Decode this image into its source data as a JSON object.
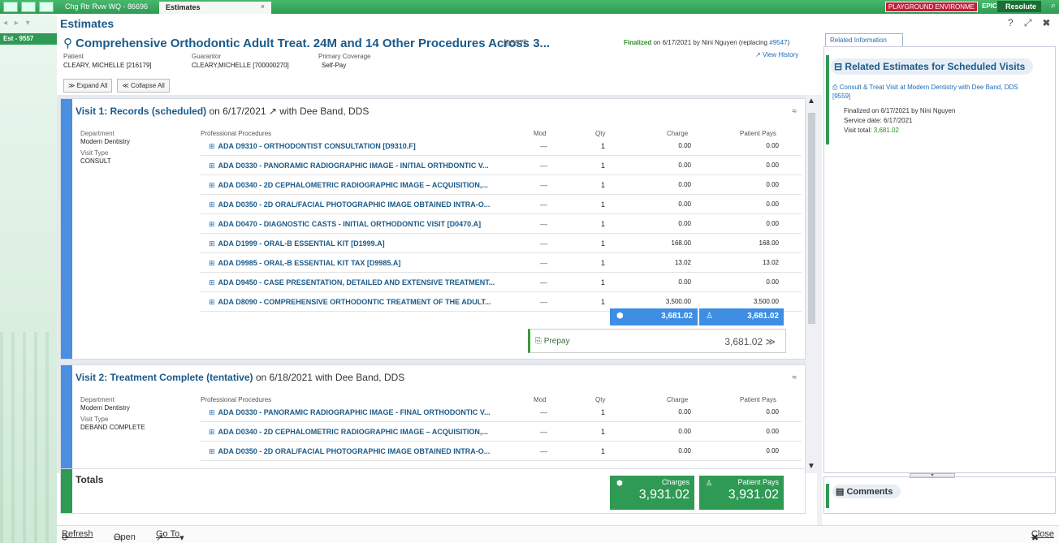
{
  "topbar": {
    "tabs": [
      "Chg Rtr Rvw WQ - 86696",
      "Estimates"
    ],
    "close": "×",
    "environment": "PLAYGROUND ENVIRONME",
    "user": "EPIC R.",
    "app": "Resolute"
  },
  "left": {
    "est_tab": "Est - 9557"
  },
  "page": {
    "title": "Estimates",
    "controls": "? ⤢ ✖"
  },
  "header": {
    "icon": "tooth-icon",
    "title": "Comprehensive Orthodontic Adult Treat. 24M and 14 Other Procedures Across 3...",
    "id": "[9557]",
    "status": "Finalized",
    "status_text": "on 6/17/2021 by Nini Nguyen (replacing",
    "replacing": "#9547",
    "status_end": ")",
    "view_history": "View History",
    "patient_label": "Patient",
    "patient": "CLEARY, MICHELLE [216179]",
    "guarantor_label": "Guarantor",
    "guarantor": "CLEARY,MICHELLE [700000270]",
    "coverage_label": "Primary Coverage",
    "coverage": "Self-Pay",
    "expand_all": "Expand All",
    "collapse_all": "Collapse All"
  },
  "columns": {
    "dept": "Department",
    "visit_type": "Visit Type",
    "procs": "Professional Procedures",
    "mod": "Mod",
    "qty": "Qty",
    "charge": "Charge",
    "pays": "Patient Pays"
  },
  "visit1": {
    "title": "Visit 1: Records (scheduled)",
    "rest": "on 6/17/2021 ↗ with Dee Band, DDS",
    "department": "Modern Dentistry",
    "visit_type": "CONSULT",
    "procedures": [
      {
        "name": "ADA D9310 - ORTHODONTIST CONSULTATION [D9310.F]",
        "mod": "—",
        "qty": "1",
        "charge": "0.00",
        "pays": "0.00"
      },
      {
        "name": "ADA D0330 - PANORAMIC RADIOGRAPHIC IMAGE - INITIAL ORTHDONTIC V...",
        "mod": "—",
        "qty": "1",
        "charge": "0.00",
        "pays": "0.00"
      },
      {
        "name": "ADA D0340 - 2D CEPHALOMETRIC RADIOGRAPHIC IMAGE – ACQUISITION,...",
        "mod": "—",
        "qty": "1",
        "charge": "0.00",
        "pays": "0.00"
      },
      {
        "name": "ADA D0350 - 2D ORAL/FACIAL PHOTOGRAPHIC IMAGE OBTAINED INTRA-O...",
        "mod": "—",
        "qty": "1",
        "charge": "0.00",
        "pays": "0.00"
      },
      {
        "name": "ADA D0470 - DIAGNOSTIC CASTS - INITIAL ORTHODONTIC VISIT [D0470.A]",
        "mod": "—",
        "qty": "1",
        "charge": "0.00",
        "pays": "0.00"
      },
      {
        "name": "ADA D1999 - ORAL-B ESSENTIAL KIT [D1999.A]",
        "mod": "—",
        "qty": "1",
        "charge": "168.00",
        "pays": "168.00"
      },
      {
        "name": "ADA D9985 - ORAL-B ESSENTIAL KIT TAX [D9985.A]",
        "mod": "—",
        "qty": "1",
        "charge": "13.02",
        "pays": "13.02"
      },
      {
        "name": "ADA D9450 - CASE PRESENTATION, DETAILED AND EXTENSIVE TREATMENT...",
        "mod": "—",
        "qty": "1",
        "charge": "0.00",
        "pays": "0.00"
      },
      {
        "name": "ADA D8090 - COMPREHENSIVE ORTHODONTIC TREATMENT OF THE ADULT...",
        "mod": "—",
        "qty": "1",
        "charge": "3,500.00",
        "pays": "3,500.00"
      }
    ],
    "sum_charge": "3,681.02",
    "sum_pays": "3,681.02",
    "prepay_label": "Prepay",
    "prepay_value": "3,681.02"
  },
  "visit2": {
    "title": "Visit 2: Treatment Complete (tentative)",
    "rest": "on 6/18/2021 with Dee Band, DDS",
    "department": "Modern Dentistry",
    "visit_type": "DEBAND COMPLETE",
    "procedures": [
      {
        "name": "ADA D0330 - PANORAMIC RADIOGRAPHIC IMAGE - FINAL ORTHODONTIC V...",
        "mod": "—",
        "qty": "1",
        "charge": "0.00",
        "pays": "0.00"
      },
      {
        "name": "ADA D0340 - 2D CEPHALOMETRIC RADIOGRAPHIC IMAGE – ACQUISITION,...",
        "mod": "—",
        "qty": "1",
        "charge": "0.00",
        "pays": "0.00"
      },
      {
        "name": "ADA D0350 - 2D ORAL/FACIAL PHOTOGRAPHIC IMAGE OBTAINED INTRA-O...",
        "mod": "—",
        "qty": "1",
        "charge": "0.00",
        "pays": "0.00"
      }
    ]
  },
  "totals": {
    "title": "Totals",
    "charges_label": "Charges",
    "charges": "3,931.02",
    "pays_label": "Patient Pays",
    "pays": "3,931.02"
  },
  "right_panel": {
    "tab": "Related Information",
    "heading": "Related Estimates for Scheduled Visits",
    "link": "Consult & Treat Visit at Modern Dentistry with Dee Band, DDS [9559]",
    "finalized": "Finalized on 6/17/2021 by Nini Nguyen",
    "service_date_label": "Service date:",
    "service_date": "6/17/2021",
    "visit_total_label": "Visit total:",
    "visit_total": "3,681.02",
    "comments": "Comments"
  },
  "bottom": {
    "refresh": "Refresh",
    "open": "Open",
    "goto": "Go To",
    "close": "Close"
  },
  "colors": {
    "accent_green": "#2f9a53",
    "accent_blue": "#3e8ee4",
    "title_blue": "#1a5a8a"
  }
}
